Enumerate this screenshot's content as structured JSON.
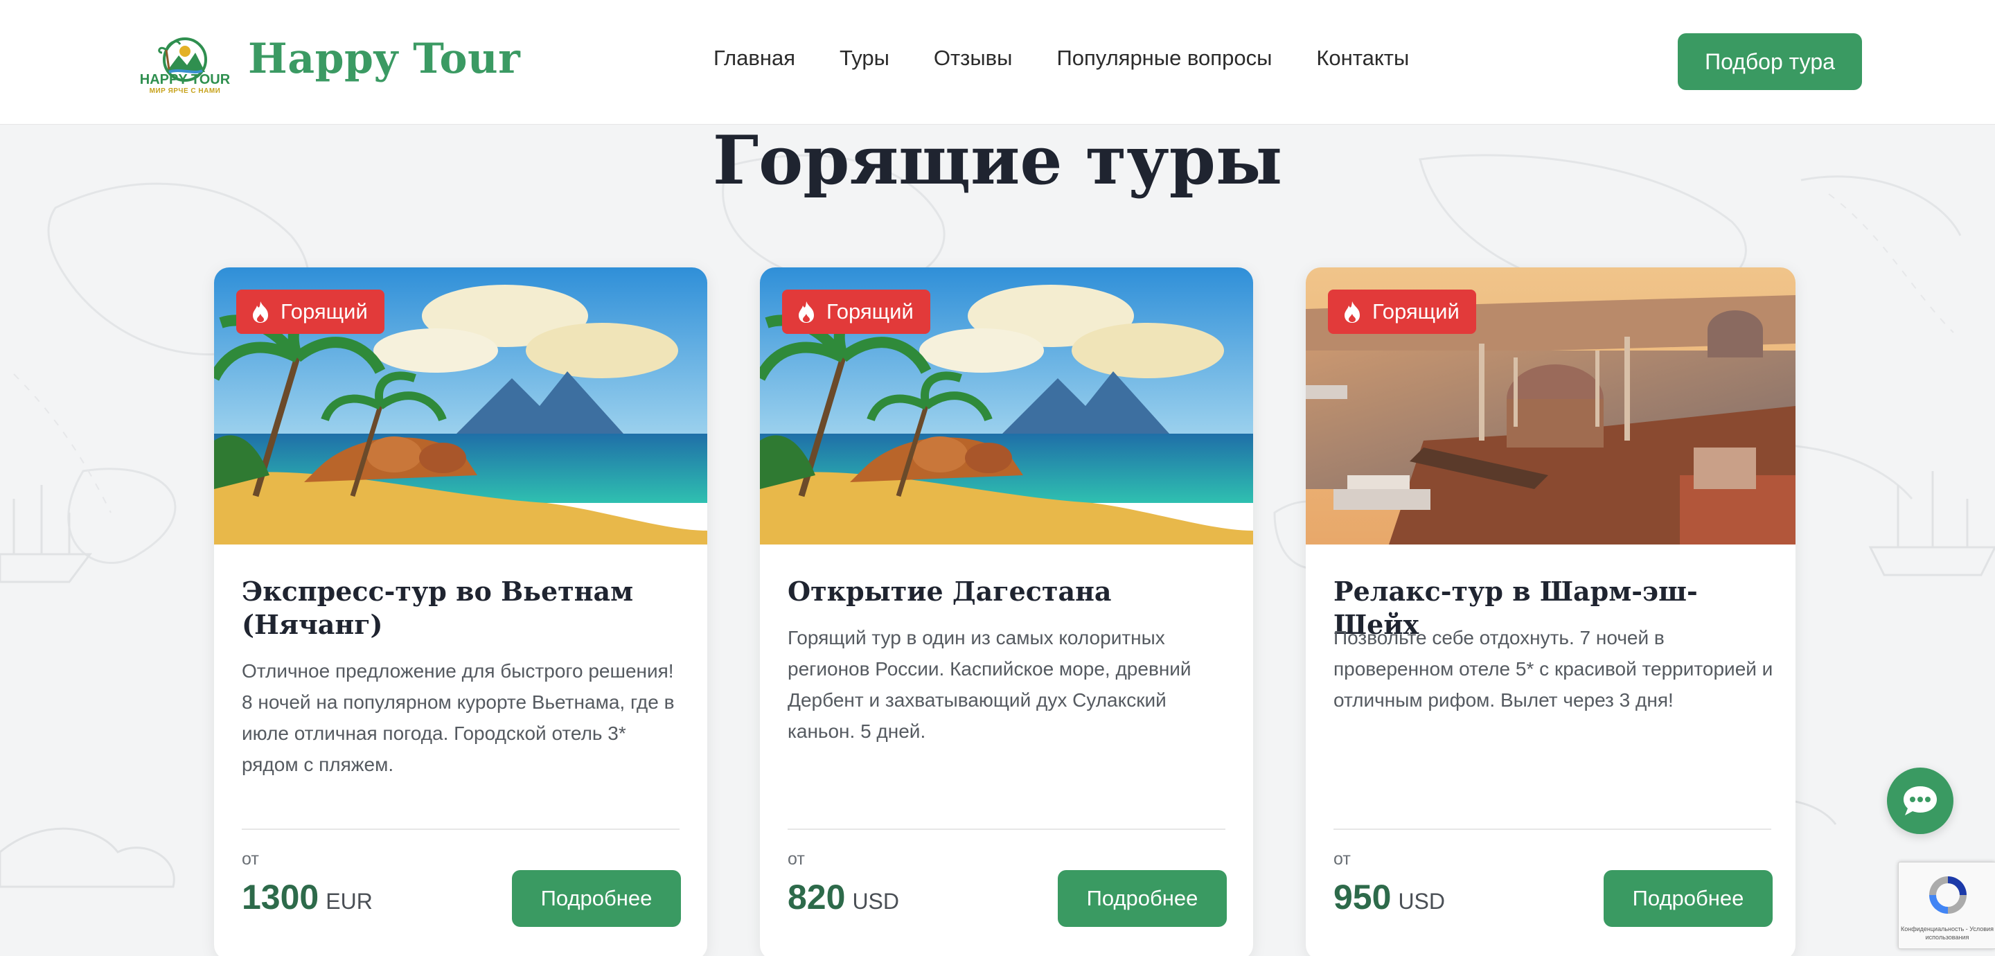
{
  "header": {
    "logo_small_name": "HAPPY TOUR",
    "logo_slogan": "МИР ЯРЧЕ С НАМИ",
    "brand": "Happy Tour",
    "nav": [
      "Главная",
      "Туры",
      "Отзывы",
      "Популярные вопросы",
      "Контакты"
    ],
    "cta_label": "Подбор тура"
  },
  "section": {
    "title": "Горящие туры"
  },
  "cards": [
    {
      "badge": "Горящий",
      "image": "tropical-beach-illustration",
      "title": "Экспресс-тур во Вьетнам (Нячанг)",
      "description": "Отличное предложение для быстрого решения! 8 ночей на популярном курорте Вьетнама, где в июле отличная погода. Городской отель 3* рядом с пляжем.",
      "price_from": "от",
      "price": "1300",
      "currency": "EUR",
      "button": "Подробнее"
    },
    {
      "badge": "Горящий",
      "image": "tropical-beach-illustration",
      "title": "Открытие Дагестана",
      "description": "Горящий тур в один из самых колоритных регионов России. Каспийское море, древний Дербент и захватывающий дух Сулакский каньон. 5 дней.",
      "price_from": "от",
      "price": "820",
      "currency": "USD",
      "button": "Подробнее"
    },
    {
      "badge": "Горящий",
      "image": "istanbul-mosque-illustration",
      "title": "Релакс-тур в Шарм-эш-Шейх",
      "description": "Позвольте себе отдохнуть. 7 ночей в проверенном отеле 5* с красивой территорией и отличным рифом. Вылет через 3 дня!",
      "price_from": "от",
      "price": "950",
      "currency": "USD",
      "button": "Подробнее"
    }
  ],
  "recaptcha": {
    "text": "Конфиденциальность - Условия использования"
  },
  "colors": {
    "accent": "#3a9a62",
    "badge": "#e23a3a",
    "brand": "#3b9a63"
  },
  "icons": {
    "chat": "chat-bubble-icon",
    "fire": "fire-icon",
    "recaptcha": "recaptcha-icon"
  }
}
